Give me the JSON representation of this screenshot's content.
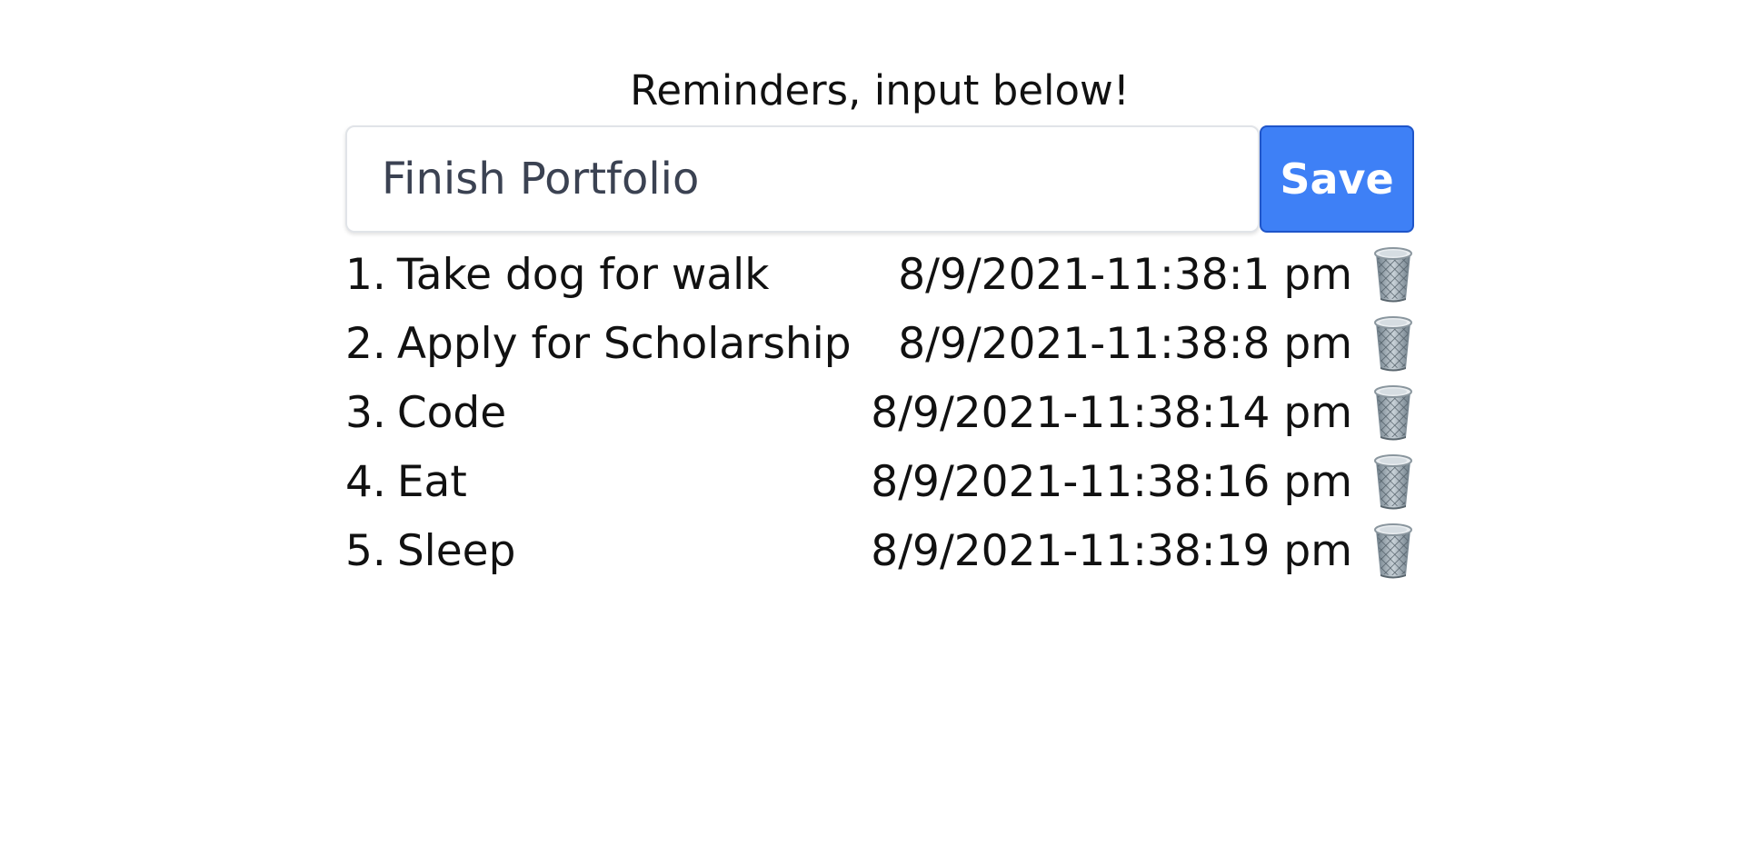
{
  "heading": "Reminders, input below!",
  "input": {
    "value": "Finish Portfolio",
    "placeholder": ""
  },
  "save_label": "Save",
  "reminders": [
    {
      "index": "1.",
      "text": "Take dog for walk",
      "timestamp": "8/9/2021-11:38:1 pm",
      "delete_icon": "trash-icon"
    },
    {
      "index": "2.",
      "text": "Apply for Scholarship",
      "timestamp": "8/9/2021-11:38:8 pm",
      "delete_icon": "trash-icon"
    },
    {
      "index": "3.",
      "text": "Code",
      "timestamp": "8/9/2021-11:38:14 pm",
      "delete_icon": "trash-icon"
    },
    {
      "index": "4.",
      "text": "Eat",
      "timestamp": "8/9/2021-11:38:16 pm",
      "delete_icon": "trash-icon"
    },
    {
      "index": "5.",
      "text": "Sleep",
      "timestamp": "8/9/2021-11:38:19 pm",
      "delete_icon": "trash-icon"
    }
  ],
  "colors": {
    "save_button": "#3e80f6",
    "save_border": "#1f55c9",
    "text": "#111111"
  }
}
